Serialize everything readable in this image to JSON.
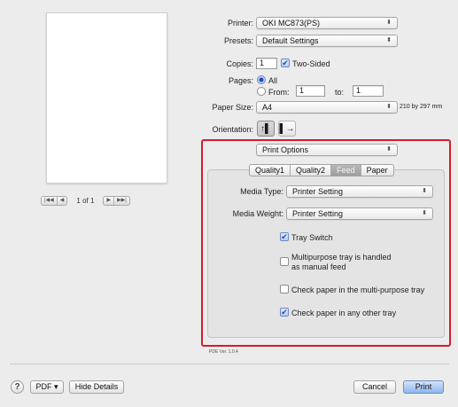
{
  "printer": {
    "label": "Printer:",
    "value": "OKI MC873(PS)"
  },
  "presets": {
    "label": "Presets:",
    "value": "Default Settings"
  },
  "copies": {
    "label": "Copies:",
    "value": "1",
    "two_sided_label": "Two-Sided",
    "two_sided_checked": true
  },
  "pages": {
    "label": "Pages:",
    "all_label": "All",
    "from_label": "From:",
    "from_value": "1",
    "to_label": "to:",
    "to_value": "1",
    "selected": "All"
  },
  "paper_size": {
    "label": "Paper Size:",
    "value": "A4",
    "dims": "210 by 297 mm"
  },
  "orientation": {
    "label": "Orientation:",
    "options": [
      "portrait",
      "landscape"
    ],
    "selected": "portrait"
  },
  "preview": {
    "page_count": "1 of 1"
  },
  "section_popup": {
    "value": "Print Options"
  },
  "tabs": [
    {
      "label": "Quality1",
      "selected": false
    },
    {
      "label": "Quality2",
      "selected": false
    },
    {
      "label": "Feed",
      "selected": true
    },
    {
      "label": "Paper",
      "selected": false
    }
  ],
  "feed": {
    "media_type_label": "Media Type:",
    "media_type_value": "Printer Setting",
    "media_weight_label": "Media Weight:",
    "media_weight_value": "Printer Setting",
    "tray_switch": {
      "label": "Tray Switch",
      "checked": true
    },
    "multipurpose_manual": {
      "line1": "Multipurpose tray is handled",
      "line2": "as manual feed",
      "checked": false
    },
    "check_mp_tray": {
      "label": "Check paper in the multi-purpose tray",
      "checked": false
    },
    "check_other_tray": {
      "label": "Check paper in any other tray",
      "checked": true
    }
  },
  "ppd_version": "PDE Ver. 1.0.4",
  "footer": {
    "help_glyph": "?",
    "pdf_label": "PDF ▾",
    "hide_details_label": "Hide Details",
    "cancel_label": "Cancel",
    "print_label": "Print"
  },
  "colors": {
    "highlight_border": "#d21d2c",
    "primary_button": "#8fb6ee"
  }
}
